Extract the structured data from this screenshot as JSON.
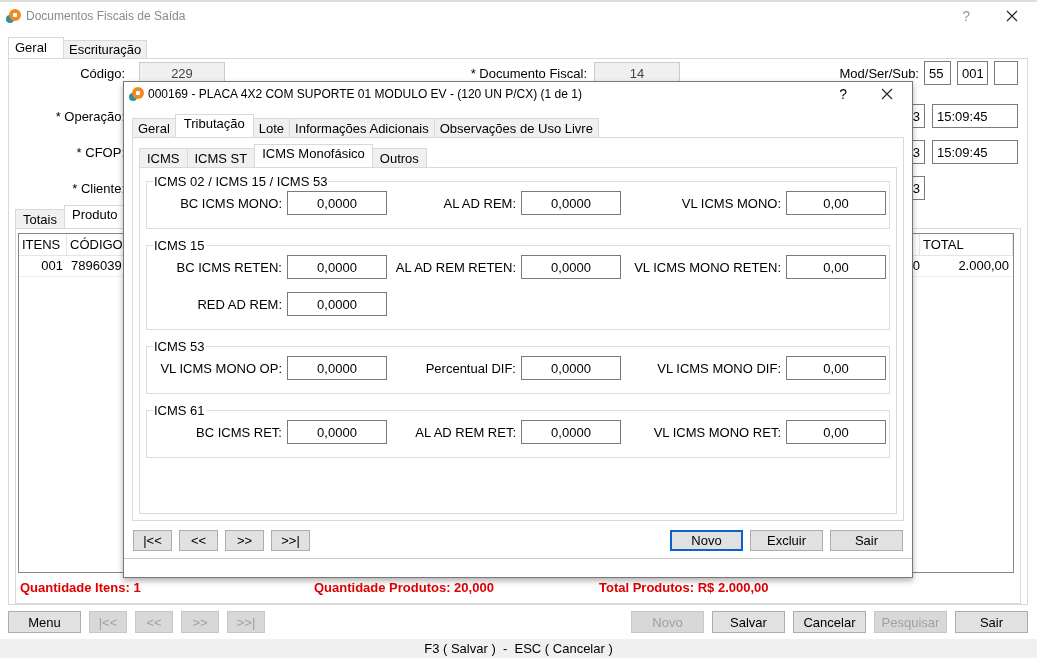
{
  "window": {
    "title": "Documentos Fiscais de Saída",
    "help": "?"
  },
  "tabs": [
    {
      "label": "Geral",
      "selected": true
    },
    {
      "label": "Escrituração",
      "selected": false
    }
  ],
  "form": {
    "codigo": {
      "label": "Código:",
      "value": "229"
    },
    "documento": {
      "label": "* Documento Fiscal:",
      "value": "14"
    },
    "mod_ser_sub": {
      "label": "Mod/Ser/Sub:",
      "values": [
        "55",
        "001"
      ]
    },
    "rows": [
      {
        "label": "* Operação:",
        "date": "3",
        "time": "15:09:45"
      },
      {
        "label": "* CFOP:",
        "date": "3",
        "time": "15:09:45"
      },
      {
        "label": "* Cliente:",
        "date": "3"
      }
    ]
  },
  "sub_tabs": [
    {
      "label": "Totais",
      "selected": false
    },
    {
      "label": "Produto",
      "selected": true
    }
  ],
  "table": {
    "columns": [
      "ITENS",
      "CÓDIGO",
      "TOTAL"
    ],
    "rows": [
      {
        "itens": "001",
        "codigo": "7896039",
        "column_3": "0",
        "total": "2.000,00"
      }
    ]
  },
  "summary": [
    "Quantidade Itens: 1",
    "Quantidade Produtos: 20,000",
    "Total Produtos: R$ 2.000,00"
  ],
  "buttons_left": [
    {
      "label": "Menu",
      "disabled": false
    },
    {
      "label": "|<<",
      "disabled": true
    },
    {
      "label": "<<",
      "disabled": true
    },
    {
      "label": ">>",
      "disabled": true
    },
    {
      "label": ">>|",
      "disabled": true
    }
  ],
  "buttons_right": [
    {
      "label": "Novo",
      "disabled": true
    },
    {
      "label": "Salvar",
      "disabled": false
    },
    {
      "label": "Cancelar",
      "disabled": false
    },
    {
      "label": "Pesquisar",
      "disabled": true
    },
    {
      "label": "Sair",
      "disabled": false
    }
  ],
  "status_bar": "F3 ( Salvar )  -  ESC ( Cancelar )",
  "dialog": {
    "title": "000169 - PLACA 4X2 COM SUPORTE 01 MODULO EV - (120 UN P/CX) (1 de 1)",
    "help": "?",
    "tabs": [
      {
        "label": "Geral",
        "selected": false
      },
      {
        "label": "Tributação",
        "selected": true
      },
      {
        "label": "Lote",
        "selected": false
      },
      {
        "label": "Informações Adicionais",
        "selected": false
      },
      {
        "label": "Observações de Uso Livre",
        "selected": false
      }
    ],
    "sub_tabs": [
      {
        "label": "ICMS",
        "selected": false
      },
      {
        "label": "ICMS ST",
        "selected": false
      },
      {
        "label": "ICMS Monofásico",
        "selected": true
      },
      {
        "label": "Outros",
        "selected": false
      }
    ],
    "groups": [
      {
        "title": "ICMS 02 / ICMS 15 / ICMS 53",
        "fields": [
          {
            "label": "BC ICMS MONO:",
            "value": "0,0000"
          },
          {
            "label": "AL AD REM:",
            "value": "0,0000"
          },
          {
            "label": "VL ICMS MONO:",
            "value": "0,00"
          }
        ]
      },
      {
        "title": "ICMS 15",
        "fields": [
          {
            "label": "BC ICMS RETEN:",
            "value": "0,0000"
          },
          {
            "label": "AL AD REM RETEN:",
            "value": "0,0000"
          },
          {
            "label": "VL ICMS MONO RETEN:",
            "value": "0,00"
          },
          {
            "label": "RED AD REM:",
            "value": "0,0000"
          }
        ]
      },
      {
        "title": "ICMS 53",
        "fields": [
          {
            "label": "VL ICMS MONO OP:",
            "value": "0,0000"
          },
          {
            "label": "Percentual DIF:",
            "value": "0,0000"
          },
          {
            "label": "VL ICMS MONO DIF:",
            "value": "0,00"
          }
        ]
      },
      {
        "title": "ICMS 61",
        "fields": [
          {
            "label": "BC ICMS RET:",
            "value": "0,0000"
          },
          {
            "label": "AL AD REM RET:",
            "value": "0,0000"
          },
          {
            "label": "VL ICMS MONO RET:",
            "value": "0,00"
          }
        ]
      }
    ],
    "nav_buttons": [
      "|<<",
      "<<",
      ">>",
      ">>|"
    ],
    "action_buttons": [
      {
        "label": "Novo",
        "focused": true
      },
      {
        "label": "Excluir",
        "focused": false
      },
      {
        "label": "Sair",
        "focused": false
      }
    ]
  }
}
